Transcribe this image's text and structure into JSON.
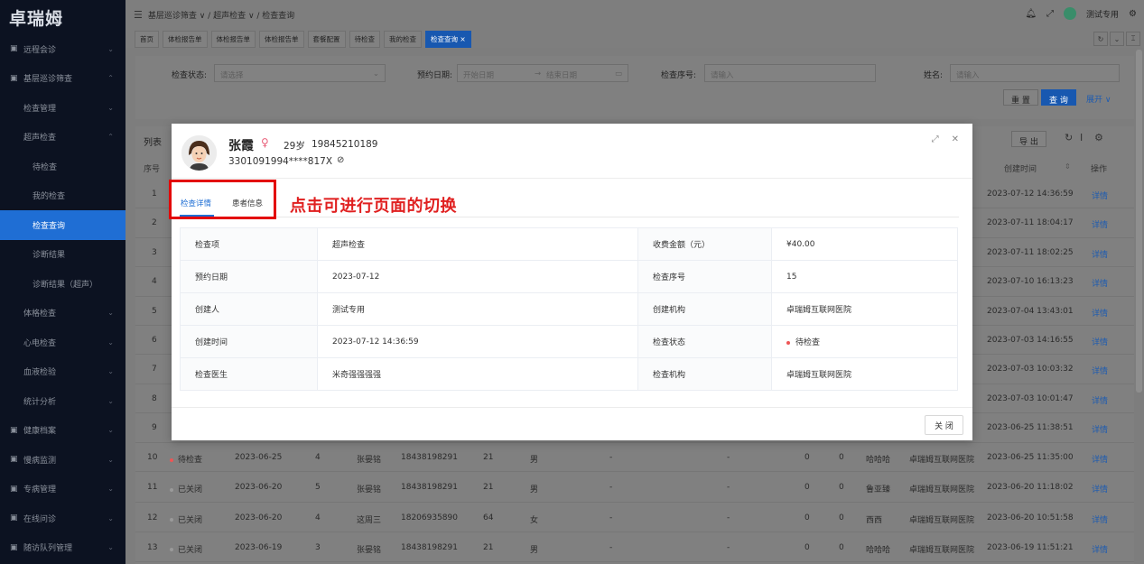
{
  "app": {
    "logo": "卓瑞姆"
  },
  "sidebar": {
    "items": [
      {
        "label": "远程会诊",
        "icon": "remote-icon",
        "level": 0,
        "active": false,
        "chev": "⌄"
      },
      {
        "label": "基层巡诊筛查",
        "icon": "screen-icon",
        "level": 0,
        "active": false,
        "chev": "⌃"
      },
      {
        "label": "检查管理",
        "level": 1,
        "active": false,
        "chev": "⌄"
      },
      {
        "label": "超声检查",
        "level": 1,
        "active": false,
        "chev": "⌃"
      },
      {
        "label": "待检查",
        "level": 2,
        "active": false
      },
      {
        "label": "我的检查",
        "level": 2,
        "active": false
      },
      {
        "label": "检查查询",
        "level": 2,
        "active": true
      },
      {
        "label": "诊断结果",
        "level": 2,
        "active": false
      },
      {
        "label": "诊断结果（超声）",
        "level": 2,
        "active": false
      },
      {
        "label": "体格检查",
        "level": 1,
        "active": false,
        "chev": "⌄"
      },
      {
        "label": "心电检查",
        "level": 1,
        "active": false,
        "chev": "⌄"
      },
      {
        "label": "血液检验",
        "level": 1,
        "active": false,
        "chev": "⌄"
      },
      {
        "label": "统计分析",
        "level": 1,
        "active": false,
        "chev": "⌄"
      },
      {
        "label": "健康档案",
        "icon": "file-icon",
        "level": 0,
        "active": false,
        "chev": "⌄"
      },
      {
        "label": "慢病监测",
        "icon": "monitor-icon",
        "level": 0,
        "active": false,
        "chev": "⌄"
      },
      {
        "label": "专病管理",
        "icon": "disease-icon",
        "level": 0,
        "active": false,
        "chev": "⌄"
      },
      {
        "label": "在线问诊",
        "icon": "consult-icon",
        "level": 0,
        "active": false,
        "chev": "⌄"
      },
      {
        "label": "随访队列管理",
        "icon": "queue-icon",
        "level": 0,
        "active": false,
        "chev": "⌄"
      }
    ]
  },
  "header": {
    "breadcrumb": "基层巡诊筛查 ∨ / 超声检查 ∨ / 检查查询",
    "user": "测试专用"
  },
  "tabs": [
    "首页",
    "体检报告单",
    "体检报告单",
    "体检报告单",
    "套餐配置",
    "待检查",
    "我的检查",
    "检查查询 ×"
  ],
  "filter": {
    "status_label": "检查状态:",
    "status_placeholder": "请选择",
    "date_label": "预约日期:",
    "date_start": "开始日期",
    "date_arrow": "→",
    "date_end": "结束日期",
    "seq_label": "检查序号:",
    "seq_placeholder": "请输入",
    "name_label": "姓名:",
    "name_placeholder": "请输入",
    "reset": "重 置",
    "query": "查 询",
    "expand": "展开 ∨"
  },
  "list": {
    "title": "列表",
    "col_seq": "序号",
    "col_created": "创建时间",
    "col_op": "操作",
    "export": "导 出"
  },
  "rows_bg": [
    {
      "seq": "1",
      "created": "2023-07-12 14:36:59"
    },
    {
      "seq": "2",
      "created": "2023-07-11 18:04:17"
    },
    {
      "seq": "3",
      "created": "2023-07-11 18:02:25"
    },
    {
      "seq": "4",
      "created": "2023-07-10 16:13:23"
    },
    {
      "seq": "5",
      "created": "2023-07-04 13:43:01"
    },
    {
      "seq": "6",
      "created": "2023-07-03 14:16:55"
    },
    {
      "seq": "7",
      "created": "2023-07-03 10:03:32"
    },
    {
      "seq": "8",
      "created": "2023-07-03 10:01:47"
    },
    {
      "seq": "9",
      "created": "2023-06-25 11:38:51"
    }
  ],
  "rows_full": [
    {
      "seq": "10",
      "status": "待检查",
      "date": "2023-06-25",
      "num": "4",
      "name": "张晏铭",
      "phone": "18438198291",
      "age": "21",
      "sex": "男",
      "d1": "-",
      "d2": "-",
      "n1": "0",
      "n2": "0",
      "doc": "哈哈哈",
      "org": "卓瑞姆互联网医院",
      "created": "2023-06-25 11:35:00"
    },
    {
      "seq": "11",
      "status": "已关闭",
      "date": "2023-06-20",
      "num": "5",
      "name": "张晏铭",
      "phone": "18438198291",
      "age": "21",
      "sex": "男",
      "d1": "-",
      "d2": "-",
      "n1": "0",
      "n2": "0",
      "doc": "鲁亚臻",
      "org": "卓瑞姆互联网医院",
      "created": "2023-06-20 11:18:02"
    },
    {
      "seq": "12",
      "status": "已关闭",
      "date": "2023-06-20",
      "num": "4",
      "name": "这周三",
      "phone": "18206935890",
      "age": "64",
      "sex": "女",
      "d1": "-",
      "d2": "-",
      "n1": "0",
      "n2": "0",
      "doc": "西西",
      "org": "卓瑞姆互联网医院",
      "created": "2023-06-20 10:51:58"
    },
    {
      "seq": "13",
      "status": "已关闭",
      "date": "2023-06-19",
      "num": "3",
      "name": "张晏铭",
      "phone": "18438198291",
      "age": "21",
      "sex": "男",
      "d1": "-",
      "d2": "-",
      "n1": "0",
      "n2": "0",
      "doc": "哈哈哈",
      "org": "卓瑞姆互联网医院",
      "created": "2023-06-19 11:51:21"
    }
  ],
  "row_link": "详情",
  "modal": {
    "name": "张霞",
    "gender_icon": "♀",
    "age": "29岁",
    "phone": "19845210189",
    "idcard": "3301091994****817X",
    "eye": "⊘",
    "tab_detail": "检查详情",
    "tab_patient": "患者信息",
    "annotation": "点击可进行页面的切换",
    "table": [
      [
        "检查项",
        "超声检查",
        "收费金额（元）",
        "¥40.00"
      ],
      [
        "预约日期",
        "2023-07-12",
        "检查序号",
        "15"
      ],
      [
        "创建人",
        "测试专用",
        "创建机构",
        "卓瑞姆互联网医院"
      ],
      [
        "创建时间",
        "2023-07-12 14:36:59",
        "检查状态",
        "待检查"
      ],
      [
        "检查医生",
        "米奇强强强强",
        "检查机构",
        "卓瑞姆互联网医院"
      ]
    ],
    "close_label": "关 闭"
  }
}
